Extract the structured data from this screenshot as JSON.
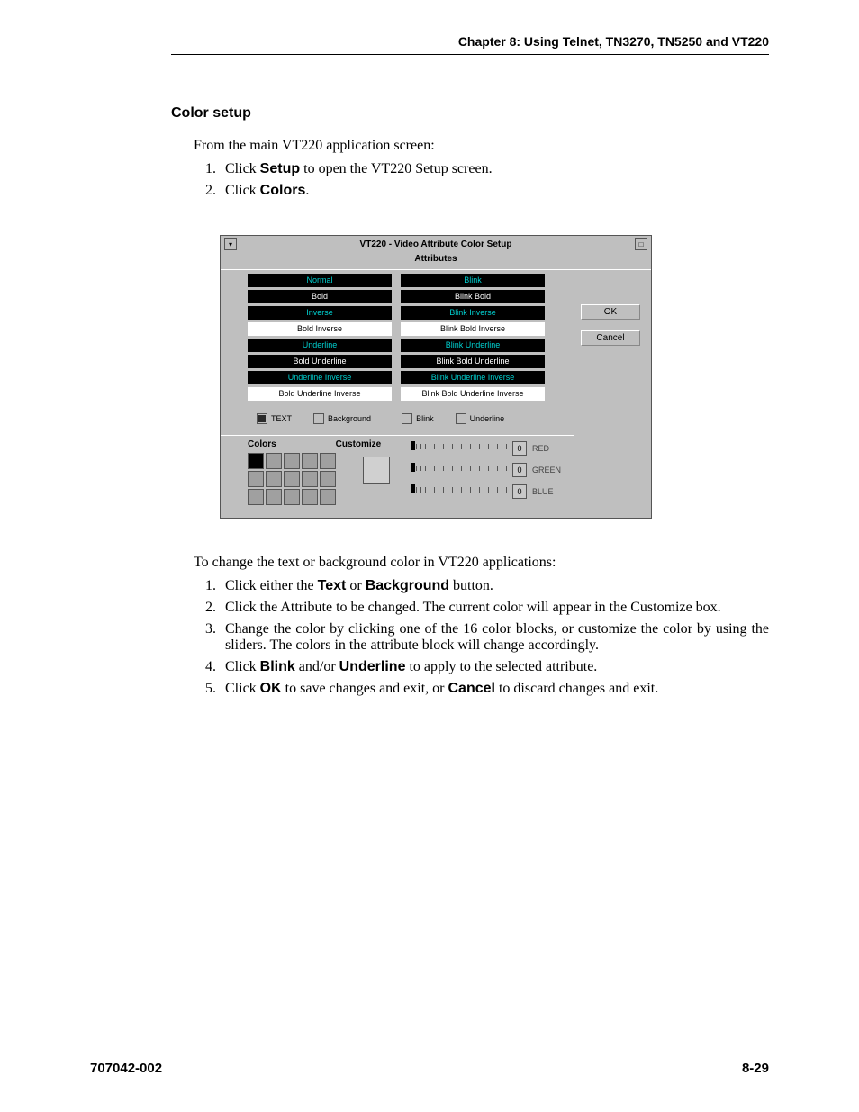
{
  "chapter_header": "Chapter 8: Using Telnet, TN3270, TN5250 and VT220",
  "section_title": "Color setup",
  "intro_text": "From the main VT220 application screen:",
  "steps1": {
    "s1_pre": "Click ",
    "s1_bold": "Setup",
    "s1_post": " to open the VT220 Setup screen.",
    "s2_pre": "Click ",
    "s2_bold": "Colors",
    "s2_post": "."
  },
  "dialog": {
    "title": "VT220 - Video Attribute Color Setup",
    "attributes_label": "Attributes",
    "left_col": [
      "Normal",
      "Bold",
      "Inverse",
      "Bold Inverse",
      "Underline",
      "Bold Underline",
      "Underline Inverse",
      "Bold Underline Inverse"
    ],
    "right_col": [
      "Blink",
      "Blink Bold",
      "Blink Inverse",
      "Blink Bold Inverse",
      "Blink Underline",
      "Blink Bold Underline",
      "Blink Underline Inverse",
      "Blink Bold Underline Inverse"
    ],
    "ok": "OK",
    "cancel": "Cancel",
    "radio_text": "TEXT",
    "radio_background": "Background",
    "radio_blink": "Blink",
    "radio_underline": "Underline",
    "colors_label": "Colors",
    "customize_label": "Customize",
    "sliders": [
      {
        "val": "0",
        "label": "RED"
      },
      {
        "val": "0",
        "label": "GREEN"
      },
      {
        "val": "0",
        "label": "BLUE"
      }
    ]
  },
  "para2": "To change the text or background color in VT220 applications:",
  "steps2": {
    "s1_a": "Click either the ",
    "s1_b": "Text",
    "s1_c": " or ",
    "s1_d": "Background",
    "s1_e": " button.",
    "s2": "Click the Attribute to be changed. The current color will appear in the Customize box.",
    "s3": "Change the color by clicking one of the 16 color blocks, or customize the color by using the sliders. The colors in the attribute block will change accordingly.",
    "s4_a": "Click ",
    "s4_b": "Blink",
    "s4_c": " and/or ",
    "s4_d": "Underline",
    "s4_e": " to apply to the selected attribute.",
    "s5_a": "Click ",
    "s5_b": "OK",
    "s5_c": " to save changes and exit, or ",
    "s5_d": "Cancel",
    "s5_e": " to discard changes and exit."
  },
  "footer_left": "707042-002",
  "footer_right": "8-29"
}
